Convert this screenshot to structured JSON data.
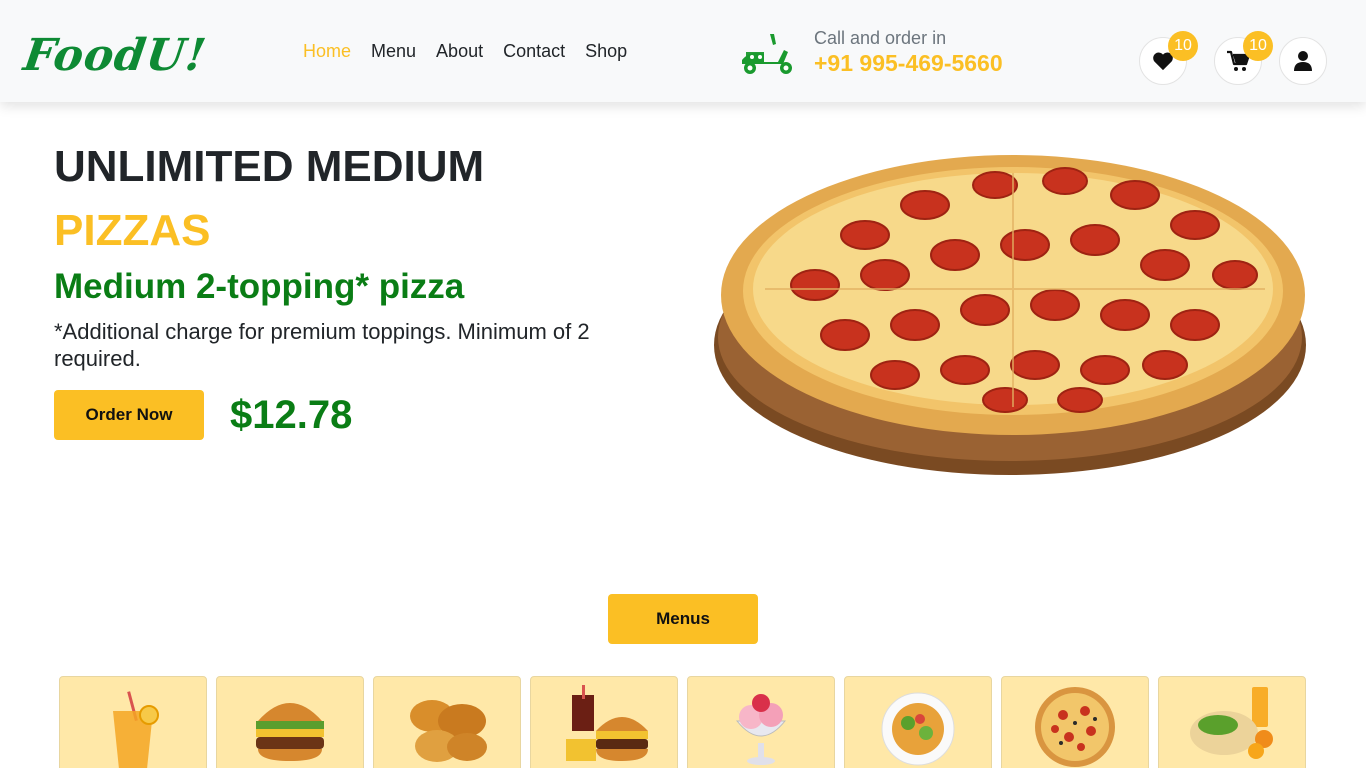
{
  "header": {
    "logo": "FoodU!",
    "nav": [
      {
        "label": "Home",
        "active": true
      },
      {
        "label": "Menu",
        "active": false
      },
      {
        "label": "About",
        "active": false
      },
      {
        "label": "Contact",
        "active": false
      },
      {
        "label": "Shop",
        "active": false
      }
    ],
    "call_label": "Call and order in",
    "call_number": "+91 995-469-5660",
    "wishlist_count": "10",
    "cart_count": "10",
    "icons": [
      "scooter-icon",
      "heart-icon",
      "cart-icon",
      "user-icon"
    ]
  },
  "hero": {
    "title": "UNLIMITED MEDIUM",
    "subtitle": "PIZZAS",
    "topping": "Medium 2-topping* pizza",
    "description": "*Additional charge for premium toppings. Minimum of 2 required.",
    "order_button": "Order Now",
    "price": "$12.78"
  },
  "menus_button": "Menus",
  "categories": [
    "drink",
    "burger",
    "fried-chicken",
    "combo-meal",
    "ice-cream",
    "salad",
    "pizza",
    "wrap"
  ],
  "colors": {
    "accent": "#fbbf24",
    "brand_green": "#0a7d15",
    "navbar_bg": "#f8f9fa",
    "category_bg": "#ffe8a8"
  }
}
